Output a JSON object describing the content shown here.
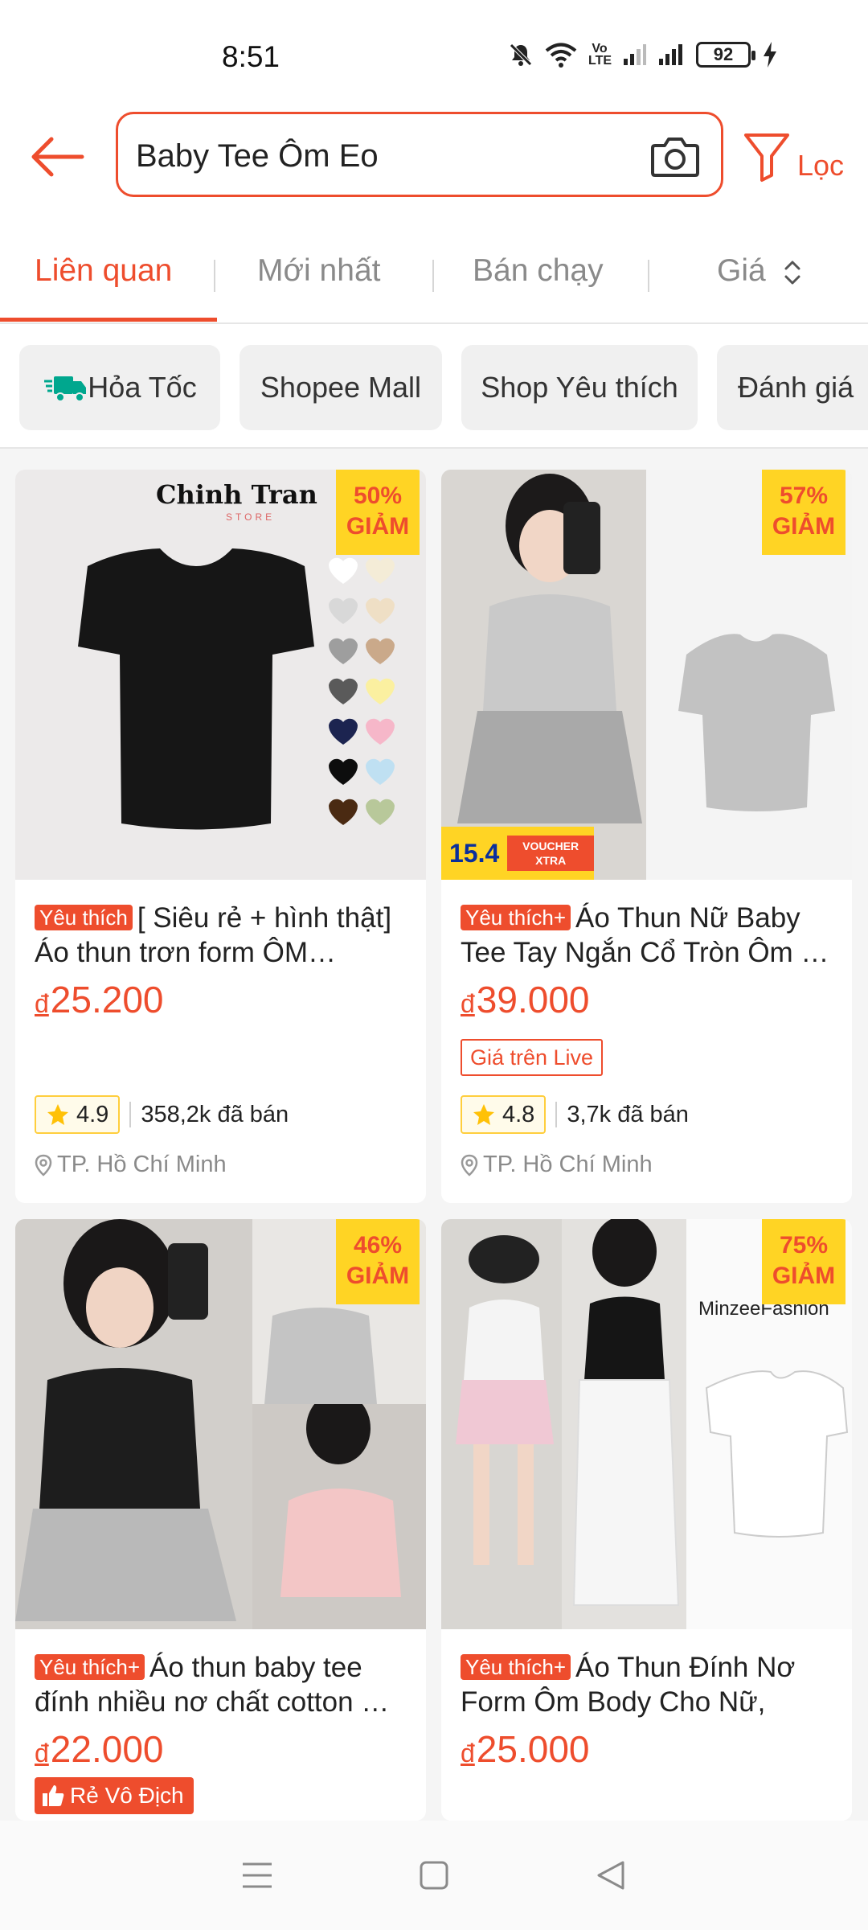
{
  "status_bar": {
    "time": "8:51",
    "volte": "Vo LTE",
    "battery": "92"
  },
  "search": {
    "query": "Baby Tee Ôm Eo",
    "filter_label": "Lọc"
  },
  "sort_tabs": [
    {
      "label": "Liên quan",
      "active": true
    },
    {
      "label": "Mới nhất",
      "active": false
    },
    {
      "label": "Bán chạy",
      "active": false
    },
    {
      "label": "Giá",
      "active": false
    }
  ],
  "chips": [
    {
      "label": "Hỏa Tốc"
    },
    {
      "label": "Shopee Mall"
    },
    {
      "label": "Shop Yêu thích"
    },
    {
      "label": "Đánh giá"
    }
  ],
  "products": [
    {
      "discount_pct": "50%",
      "discount_word": "GIẢM",
      "brand_overlay": "Chinh Tran",
      "brand_sub": "STORE",
      "tag": "Yêu thích",
      "title": "[ Siêu rẻ + hình thật] Áo thun trơn form ÔM…",
      "currency": "đ",
      "price": "25.200",
      "rating": "4.9",
      "sold": "358,2k đã bán",
      "location": "TP. Hồ Chí Minh"
    },
    {
      "discount_pct": "57%",
      "discount_word": "GIẢM",
      "voucher_num": "15.4",
      "voucher_label": "VOUCHER XTRA",
      "tag": "Yêu thích+",
      "title": "Áo Thun Nữ Baby Tee Tay Ngắn Cổ Tròn Ôm …",
      "currency": "đ",
      "price": "39.000",
      "live_badge": "Giá trên Live",
      "rating": "4.8",
      "sold": "3,7k đã bán",
      "location": "TP. Hồ Chí Minh"
    },
    {
      "discount_pct": "46%",
      "discount_word": "GIẢM",
      "tag": "Yêu thích+",
      "title": "Áo thun baby tee đính nhiều nơ chất cotton …",
      "currency": "đ",
      "price": "22.000",
      "cheap_badge": "Rẻ Vô Địch"
    },
    {
      "discount_pct": "75%",
      "discount_word": "GIẢM",
      "brand_overlay": "MinzeeFashion",
      "tag": "Yêu thích+",
      "title": "Áo Thun Đính Nơ Form Ôm Body Cho Nữ, Ba…",
      "currency": "đ",
      "price": "25.000"
    }
  ],
  "colors": {
    "accent": "#ee4d2d",
    "discount_bg": "#ffd424",
    "rating_border": "#ffce3d"
  },
  "icons": {
    "back": "arrow-left-icon",
    "camera": "camera-icon",
    "filter": "filter-icon",
    "express": "delivery-truck-icon",
    "star": "star-icon",
    "location": "location-pin-icon"
  }
}
